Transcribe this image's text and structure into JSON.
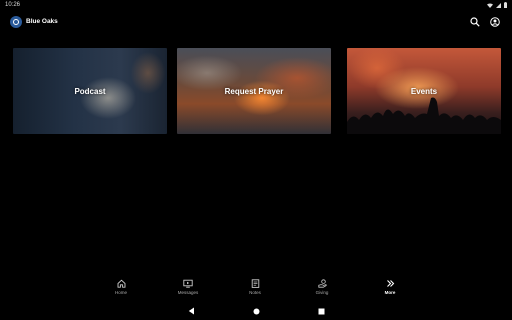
{
  "status_bar": {
    "time": "10:26"
  },
  "app_bar": {
    "title": "Blue Oaks",
    "search_icon": "search-icon",
    "account_icon": "account-circle-icon"
  },
  "tiles": [
    {
      "label": "Podcast"
    },
    {
      "label": "Request Prayer"
    },
    {
      "label": "Events"
    }
  ],
  "bottom_nav": {
    "items": [
      {
        "label": "Home",
        "icon": "home-icon",
        "active": false
      },
      {
        "label": "Messages",
        "icon": "tv-icon",
        "active": false
      },
      {
        "label": "Notes",
        "icon": "notes-icon",
        "active": false
      },
      {
        "label": "Giving",
        "icon": "giving-icon",
        "active": false
      },
      {
        "label": "More",
        "icon": "double-chevron-right-icon",
        "active": true
      }
    ]
  },
  "colors": {
    "background": "#000000",
    "logo": "#2a5a9a",
    "nav_inactive": "#aaaaaa",
    "nav_active": "#ffffff"
  }
}
